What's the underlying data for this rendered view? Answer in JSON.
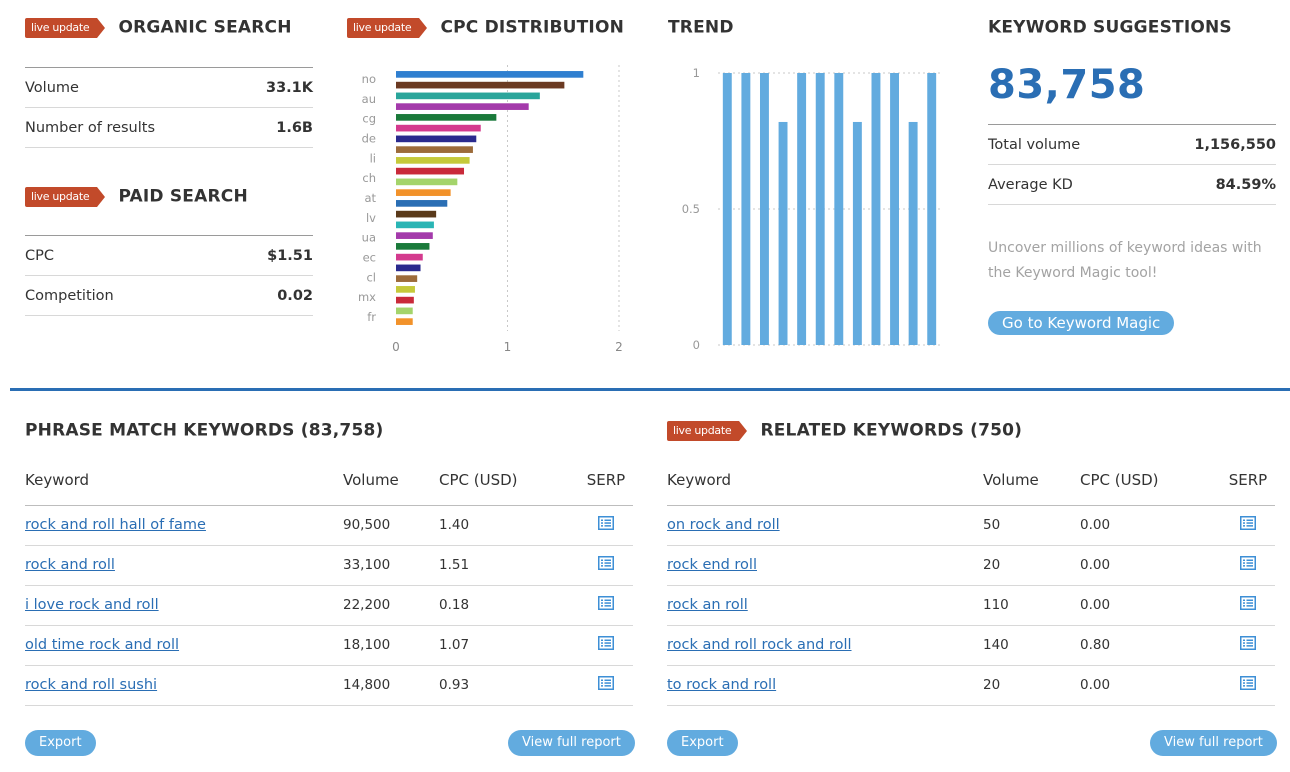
{
  "organic": {
    "badge": "live update",
    "title": "ORGANIC SEARCH",
    "rows": [
      {
        "label": "Volume",
        "value": "33.1K"
      },
      {
        "label": "Number of results",
        "value": "1.6B"
      }
    ]
  },
  "paid": {
    "badge": "live update",
    "title": "PAID SEARCH",
    "rows": [
      {
        "label": "CPC",
        "value": "$1.51"
      },
      {
        "label": "Competition",
        "value": "0.02"
      }
    ]
  },
  "cpc_chart": {
    "badge": "live update",
    "title": "CPC DISTRIBUTION"
  },
  "trend_chart": {
    "title": "TREND"
  },
  "suggestions": {
    "title": "KEYWORD SUGGESTIONS",
    "count": "83,758",
    "rows": [
      {
        "label": "Total volume",
        "value": "1,156,550"
      },
      {
        "label": "Average KD",
        "value": "84.59%"
      }
    ],
    "promo_line1": "Uncover millions of keyword ideas with",
    "promo_line2": "the Keyword Magic tool!",
    "button": "Go to Keyword Magic"
  },
  "phrase": {
    "title": "PHRASE MATCH KEYWORDS (83,758)",
    "columns": [
      "Keyword",
      "Volume",
      "CPC (USD)",
      "SERP"
    ],
    "rows": [
      {
        "keyword": "rock and roll hall of fame",
        "volume": "90,500",
        "cpc": "1.40"
      },
      {
        "keyword": "rock and roll",
        "volume": "33,100",
        "cpc": "1.51"
      },
      {
        "keyword": "i love rock and roll",
        "volume": "22,200",
        "cpc": "0.18"
      },
      {
        "keyword": "old time rock and roll",
        "volume": "18,100",
        "cpc": "1.07"
      },
      {
        "keyword": "rock and roll sushi",
        "volume": "14,800",
        "cpc": "0.93"
      }
    ],
    "export": "Export",
    "full_report": "View full report"
  },
  "related": {
    "badge": "live update",
    "title": "RELATED KEYWORDS (750)",
    "columns": [
      "Keyword",
      "Volume",
      "CPC (USD)",
      "SERP"
    ],
    "rows": [
      {
        "keyword": "on rock and roll",
        "volume": "50",
        "cpc": "0.00"
      },
      {
        "keyword": "rock end roll",
        "volume": "20",
        "cpc": "0.00"
      },
      {
        "keyword": "rock an roll",
        "volume": "110",
        "cpc": "0.00"
      },
      {
        "keyword": "rock and roll rock and roll",
        "volume": "140",
        "cpc": "0.80"
      },
      {
        "keyword": "to rock and roll",
        "volume": "20",
        "cpc": "0.00"
      }
    ],
    "export": "Export",
    "full_report": "View full report"
  },
  "colors": {
    "accent": "#2a6eb4",
    "badge": "#c24a2a",
    "button": "#62abdf",
    "trend_bar": "#62abdf"
  },
  "icons": {
    "serp": "serp-list-icon"
  },
  "chart_data": [
    {
      "type": "bar",
      "orientation": "horizontal",
      "categories": [
        "no",
        "au",
        "cg",
        "de",
        "li",
        "ch",
        "at",
        "lv",
        "ua",
        "ec",
        "cl",
        "mx",
        "fr"
      ],
      "series": [
        {
          "values": [
            1.68,
            1.51,
            1.29,
            1.19,
            0.9,
            0.76,
            0.72,
            0.69,
            0.66,
            0.61,
            0.55,
            0.49,
            0.46,
            0.36,
            0.34,
            0.33,
            0.3,
            0.24,
            0.22,
            0.19,
            0.17,
            0.16,
            0.15,
            0.15
          ]
        }
      ],
      "bar_colors": [
        "#2f7fd0",
        "#6b3a22",
        "#2aa59b",
        "#a43aab",
        "#1a7a3a",
        "#d43a8e",
        "#2a2a8e",
        "#9c6b3a",
        "#c5c93a",
        "#c92a3a",
        "#a4d46b",
        "#f2922a",
        "#2a6eb4",
        "#5a3a1a",
        "#2ab5b5",
        "#a43aab",
        "#1a7a3a",
        "#d43a8e",
        "#2a2a8e",
        "#9c6b3a",
        "#c5c93a",
        "#c92a3a",
        "#a4d46b",
        "#f2922a",
        "#2a6eb4"
      ],
      "xlim": [
        0,
        2
      ],
      "xticks": [
        0,
        1,
        2
      ],
      "grid": true
    },
    {
      "type": "bar",
      "values": [
        1,
        1,
        1,
        0.82,
        1,
        1,
        1,
        0.82,
        1,
        1,
        0.82,
        1
      ],
      "ylim": [
        0,
        1
      ],
      "yticks": [
        0,
        0.5,
        1
      ],
      "grid": true
    }
  ]
}
